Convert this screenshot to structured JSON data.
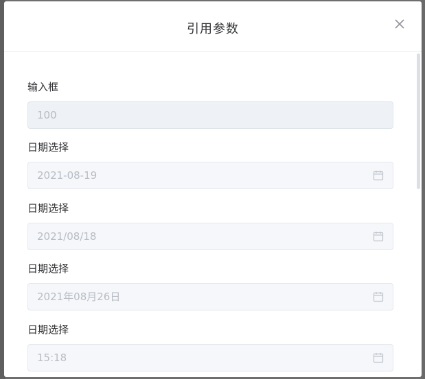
{
  "dialog": {
    "title": "引用参数"
  },
  "fields": [
    {
      "label": "输入框",
      "value": "100",
      "type": "input"
    },
    {
      "label": "日期选择",
      "value": "2021-08-19",
      "type": "date"
    },
    {
      "label": "日期选择",
      "value": "2021/08/18",
      "type": "date"
    },
    {
      "label": "日期选择",
      "value": "2021年08月26日",
      "type": "date"
    },
    {
      "label": "日期选择",
      "value": "15:18",
      "type": "time"
    }
  ],
  "icons": {
    "close": "close-icon",
    "calendar": "calendar-icon"
  },
  "colors": {
    "label": "#303133",
    "placeholder_text": "#b8bcc3",
    "input_bg": "#eef2f6",
    "disabled_bg": "#f5f7fa",
    "border": "#e4e7ed"
  }
}
